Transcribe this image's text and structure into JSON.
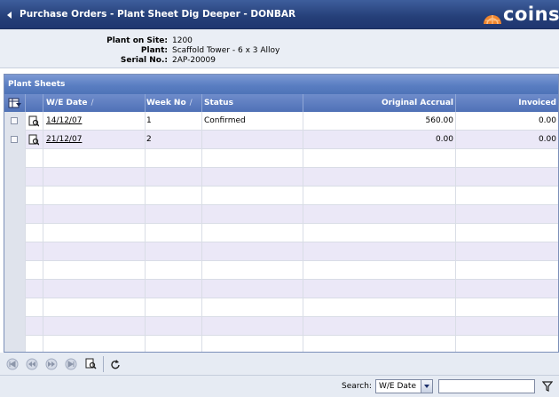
{
  "header": {
    "title": "Purchase Orders - Plant Sheet Dig Deeper - DONBAR",
    "logo_text": "coins"
  },
  "plant_info": {
    "plant_on_site_label": "Plant on Site:",
    "plant_on_site_value": "1200",
    "plant_label": "Plant:",
    "plant_value": "Scaffold Tower - 6 x 3 Alloy",
    "serial_label": "Serial No.:",
    "serial_value": "2AP-20009"
  },
  "plant_sheets": {
    "title": "Plant Sheets",
    "columns": {
      "we_date": "W/E Date",
      "week_no": "Week No",
      "status": "Status",
      "original_accrual": "Original Accrual",
      "invoiced": "Invoiced",
      "sort_indicator": "/"
    },
    "rows": [
      {
        "we_date": "14/12/07",
        "week_no": "1",
        "status": "Confirmed",
        "original_accrual": "560.00",
        "invoiced": "0.00"
      },
      {
        "we_date": "21/12/07",
        "week_no": "2",
        "status": "",
        "original_accrual": "0.00",
        "invoiced": "0.00"
      }
    ]
  },
  "search": {
    "label": "Search:",
    "field_selected": "W/E Date",
    "value": ""
  },
  "icons": {
    "pager": [
      "first-page-icon",
      "previous-page-icon",
      "next-page-icon",
      "last-page-icon",
      "view-icon",
      "refresh-icon"
    ],
    "filter": "filter-icon"
  },
  "colors": {
    "title_bar": "#253f78",
    "panel_header": "#5a7ec2",
    "alt_row": "#ebe8f7",
    "logo_accent": "#f0852d"
  }
}
